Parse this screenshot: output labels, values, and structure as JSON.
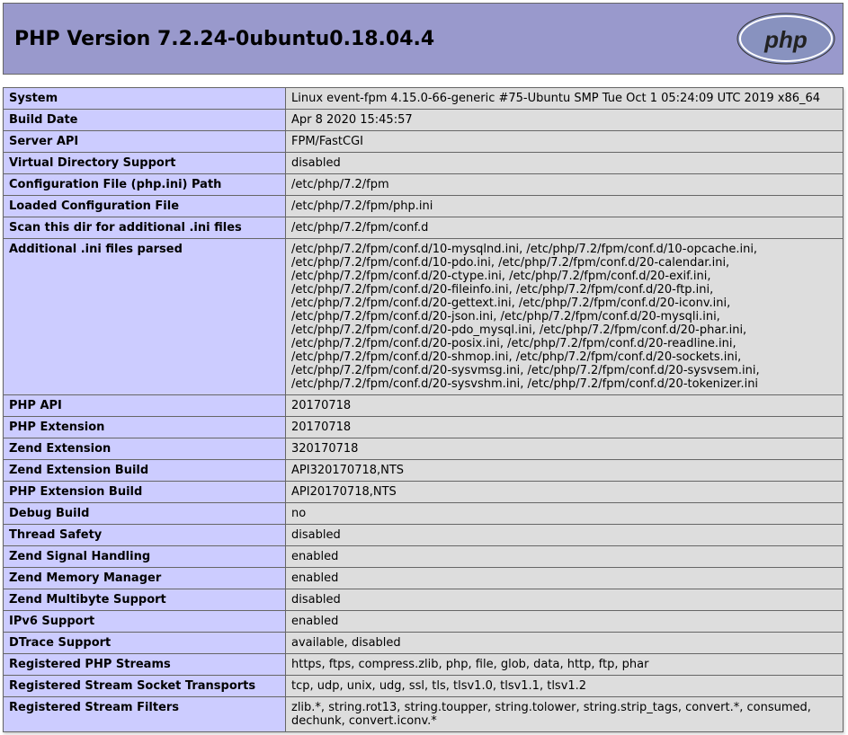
{
  "header": {
    "title": "PHP Version 7.2.24-0ubuntu0.18.04.4"
  },
  "rows": [
    {
      "label": "System",
      "value": "Linux event-fpm 4.15.0-66-generic #75-Ubuntu SMP Tue Oct 1 05:24:09 UTC 2019 x86_64"
    },
    {
      "label": "Build Date",
      "value": "Apr 8 2020 15:45:57"
    },
    {
      "label": "Server API",
      "value": "FPM/FastCGI"
    },
    {
      "label": "Virtual Directory Support",
      "value": "disabled"
    },
    {
      "label": "Configuration File (php.ini) Path",
      "value": "/etc/php/7.2/fpm"
    },
    {
      "label": "Loaded Configuration File",
      "value": "/etc/php/7.2/fpm/php.ini"
    },
    {
      "label": "Scan this dir for additional .ini files",
      "value": "/etc/php/7.2/fpm/conf.d"
    },
    {
      "label": "Additional .ini files parsed",
      "value": "/etc/php/7.2/fpm/conf.d/10-mysqlnd.ini, /etc/php/7.2/fpm/conf.d/10-opcache.ini, /etc/php/7.2/fpm/conf.d/10-pdo.ini, /etc/php/7.2/fpm/conf.d/20-calendar.ini, /etc/php/7.2/fpm/conf.d/20-ctype.ini, /etc/php/7.2/fpm/conf.d/20-exif.ini, /etc/php/7.2/fpm/conf.d/20-fileinfo.ini, /etc/php/7.2/fpm/conf.d/20-ftp.ini, /etc/php/7.2/fpm/conf.d/20-gettext.ini, /etc/php/7.2/fpm/conf.d/20-iconv.ini, /etc/php/7.2/fpm/conf.d/20-json.ini, /etc/php/7.2/fpm/conf.d/20-mysqli.ini, /etc/php/7.2/fpm/conf.d/20-pdo_mysql.ini, /etc/php/7.2/fpm/conf.d/20-phar.ini, /etc/php/7.2/fpm/conf.d/20-posix.ini, /etc/php/7.2/fpm/conf.d/20-readline.ini, /etc/php/7.2/fpm/conf.d/20-shmop.ini, /etc/php/7.2/fpm/conf.d/20-sockets.ini, /etc/php/7.2/fpm/conf.d/20-sysvmsg.ini, /etc/php/7.2/fpm/conf.d/20-sysvsem.ini, /etc/php/7.2/fpm/conf.d/20-sysvshm.ini, /etc/php/7.2/fpm/conf.d/20-tokenizer.ini"
    },
    {
      "label": "PHP API",
      "value": "20170718"
    },
    {
      "label": "PHP Extension",
      "value": "20170718"
    },
    {
      "label": "Zend Extension",
      "value": "320170718"
    },
    {
      "label": "Zend Extension Build",
      "value": "API320170718,NTS"
    },
    {
      "label": "PHP Extension Build",
      "value": "API20170718,NTS"
    },
    {
      "label": "Debug Build",
      "value": "no"
    },
    {
      "label": "Thread Safety",
      "value": "disabled"
    },
    {
      "label": "Zend Signal Handling",
      "value": "enabled"
    },
    {
      "label": "Zend Memory Manager",
      "value": "enabled"
    },
    {
      "label": "Zend Multibyte Support",
      "value": "disabled"
    },
    {
      "label": "IPv6 Support",
      "value": "enabled"
    },
    {
      "label": "DTrace Support",
      "value": "available, disabled"
    },
    {
      "label": "Registered PHP Streams",
      "value": "https, ftps, compress.zlib, php, file, glob, data, http, ftp, phar"
    },
    {
      "label": "Registered Stream Socket Transports",
      "value": "tcp, udp, unix, udg, ssl, tls, tlsv1.0, tlsv1.1, tlsv1.2"
    },
    {
      "label": "Registered Stream Filters",
      "value": "zlib.*, string.rot13, string.toupper, string.tolower, string.strip_tags, convert.*, consumed, dechunk, convert.iconv.*"
    }
  ]
}
